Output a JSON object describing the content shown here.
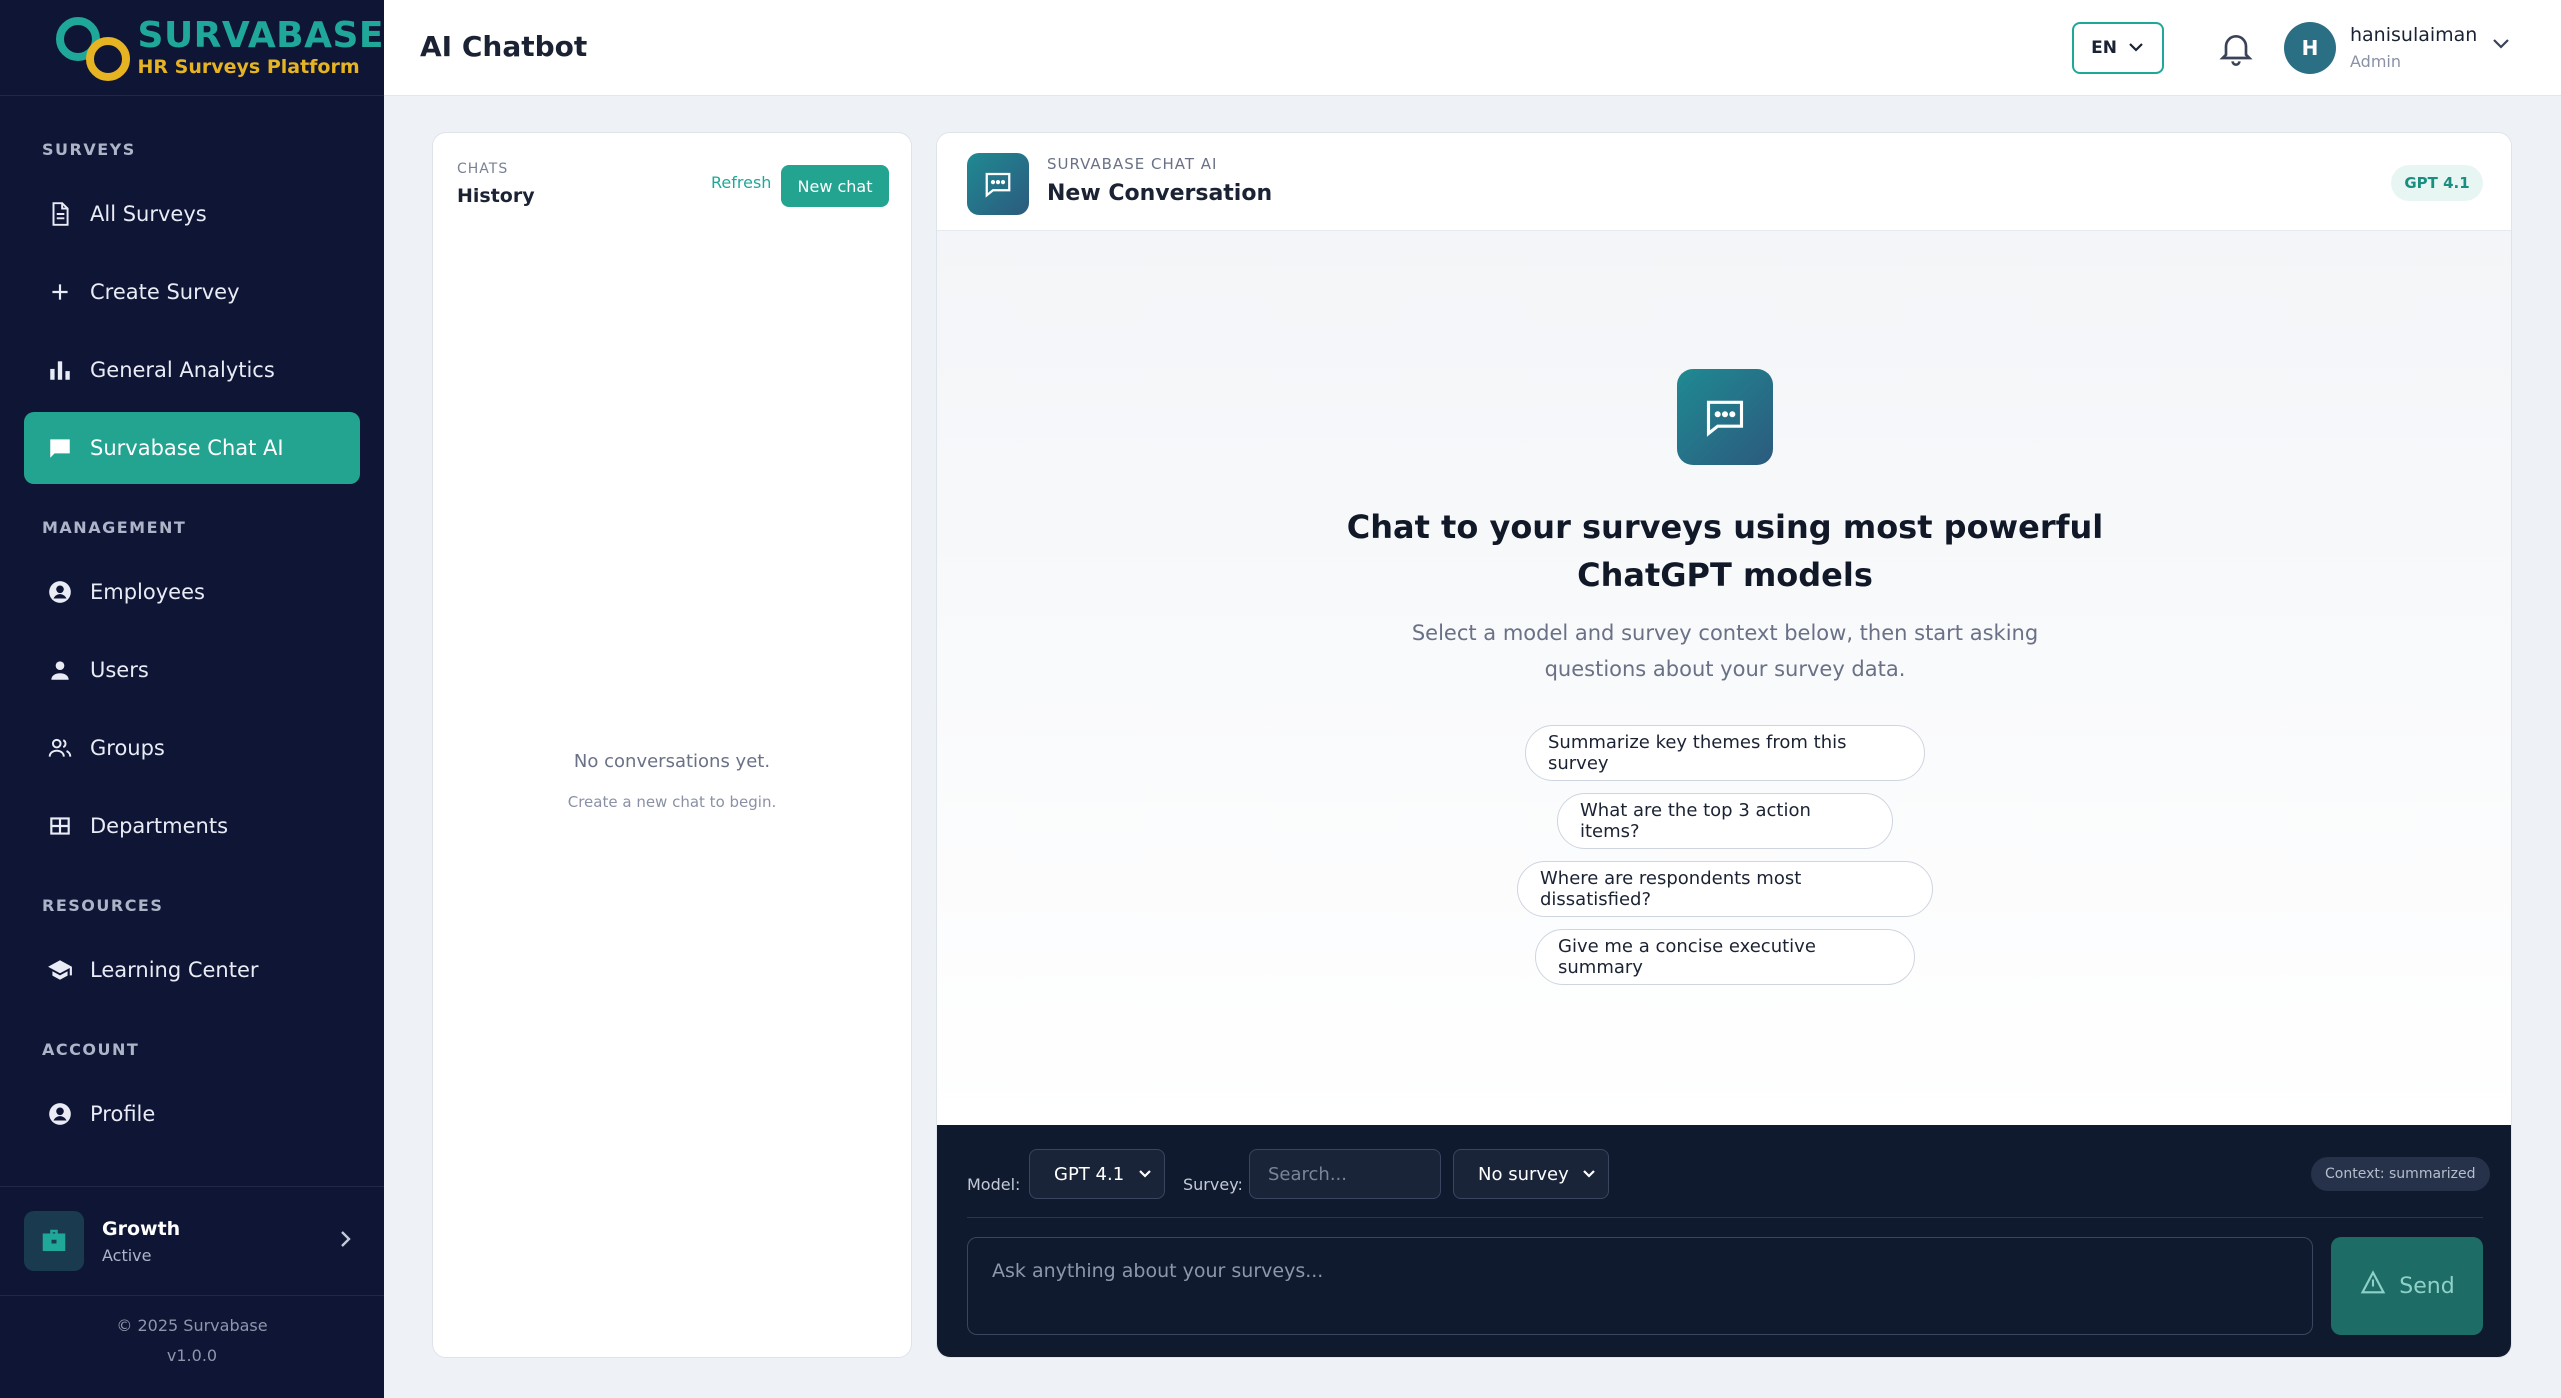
{
  "brand": {
    "name": "SURVABASE",
    "tagline": "HR Surveys Platform"
  },
  "sidebar": {
    "sections": [
      {
        "title": "SURVEYS"
      },
      {
        "title": "MANAGEMENT"
      },
      {
        "title": "RESOURCES"
      },
      {
        "title": "ACCOUNT"
      }
    ],
    "items": [
      {
        "label": "All Surveys",
        "icon": "document-icon"
      },
      {
        "label": "Create Survey",
        "icon": "plus-icon"
      },
      {
        "label": "General Analytics",
        "icon": "bar-chart-icon"
      },
      {
        "label": "Survabase Chat AI",
        "icon": "chat-icon",
        "active": true
      },
      {
        "label": "Employees",
        "icon": "user-circle-icon"
      },
      {
        "label": "Users",
        "icon": "person-icon"
      },
      {
        "label": "Groups",
        "icon": "group-icon"
      },
      {
        "label": "Departments",
        "icon": "grid-icon"
      },
      {
        "label": "Learning Center",
        "icon": "graduation-cap-icon"
      },
      {
        "label": "Profile",
        "icon": "user-circle-icon"
      }
    ],
    "plan": {
      "name": "Growth",
      "status": "Active"
    },
    "footer": {
      "copyright": "© 2025 Survabase",
      "version": "v1.0.0"
    }
  },
  "header": {
    "title": "AI Chatbot",
    "language": "EN",
    "user": {
      "initial": "H",
      "name": "hanisulaiman",
      "role": "Admin"
    }
  },
  "history": {
    "kicker": "CHATS",
    "title": "History",
    "refresh_label": "Refresh",
    "new_chat_label": "New chat",
    "empty_title": "No conversations yet.",
    "empty_hint": "Create a new chat to begin."
  },
  "chat": {
    "kicker": "SURVABASE CHAT AI",
    "title": "New Conversation",
    "model_badge": "GPT 4.1",
    "hero_title": "Chat to your surveys using most powerful ChatGPT models",
    "hero_subtitle": "Select a model and survey context below, then start asking questions about your survey data.",
    "suggestions": [
      "Summarize key themes from this survey",
      "What are the top 3 action items?",
      "Where are respondents most dissatisfied?",
      "Give me a concise executive summary"
    ]
  },
  "composer": {
    "model_label": "Model:",
    "model_value": "GPT 4.1",
    "survey_label": "Survey:",
    "survey_search_placeholder": "Search...",
    "survey_value": "No survey",
    "context_badge": "Context: summarized",
    "message_placeholder": "Ask anything about your surveys...",
    "send_label": "Send"
  },
  "colors": {
    "sidebar_bg": "#0f1535",
    "accent": "#23a491",
    "brand_teal": "#1fa89a",
    "brand_gold": "#e6b422",
    "composer_bg": "#0f1a2e"
  }
}
